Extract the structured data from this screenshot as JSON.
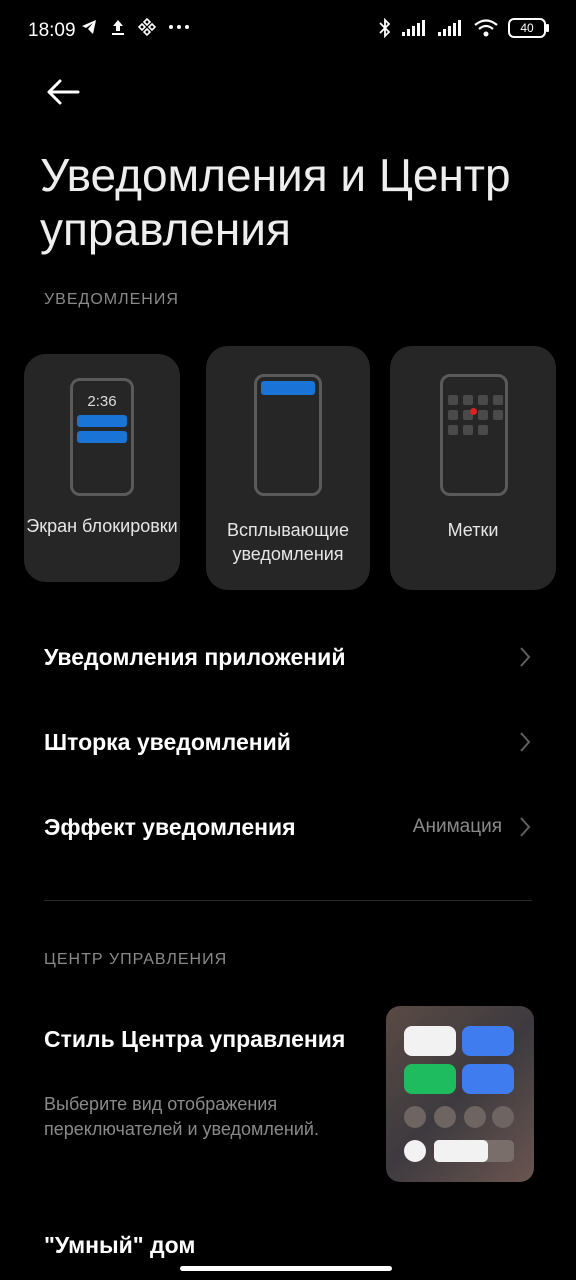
{
  "status_bar": {
    "time": "18:09",
    "left_icons": [
      "telegram-icon",
      "upload-icon",
      "binance-icon",
      "more-dots-icon"
    ],
    "right_icons": [
      "bluetooth-icon",
      "signal-icon",
      "signal-icon",
      "wifi-icon"
    ],
    "battery": "40"
  },
  "header": {
    "title": "Уведомления и Центр управления"
  },
  "notifications": {
    "section_label": "УВЕДОМЛЕНИЯ",
    "cards": [
      {
        "label": "Экран блокировки",
        "preview_time": "2:36"
      },
      {
        "label": "Всплывающие уведомления"
      },
      {
        "label": "Метки"
      }
    ],
    "rows": [
      {
        "title": "Уведомления приложений",
        "value": ""
      },
      {
        "title": "Шторка уведомлений",
        "value": ""
      },
      {
        "title": "Эффект уведомления",
        "value": "Анимация"
      }
    ]
  },
  "control_center": {
    "section_label": "ЦЕНТР УПРАВЛЕНИЯ",
    "style_title": "Стиль Центра управления",
    "style_desc": "Выберите вид отображения переключателей и уведомлений.",
    "smart_home": "\"Умный\" дом"
  },
  "colors": {
    "accent_blue": "#1a73d6",
    "tile_blue": "#3f7cf0",
    "tile_green": "#1ebc5e",
    "card_bg": "#262626"
  }
}
